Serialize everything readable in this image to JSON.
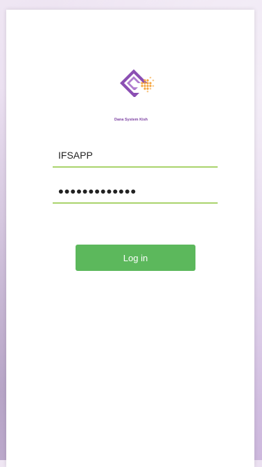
{
  "brand": {
    "name": "Dana System Kish",
    "logo_icon": "diamond-logo-icon",
    "colors": {
      "purple": "#8b4fb3",
      "orange": "#f5a33a"
    }
  },
  "form": {
    "username_value": "IFSAPP",
    "password_value": "•••••••••••••",
    "login_label": "Log in"
  },
  "colors": {
    "accent_underline": "#a9d36b",
    "button": "#5cb85c"
  }
}
